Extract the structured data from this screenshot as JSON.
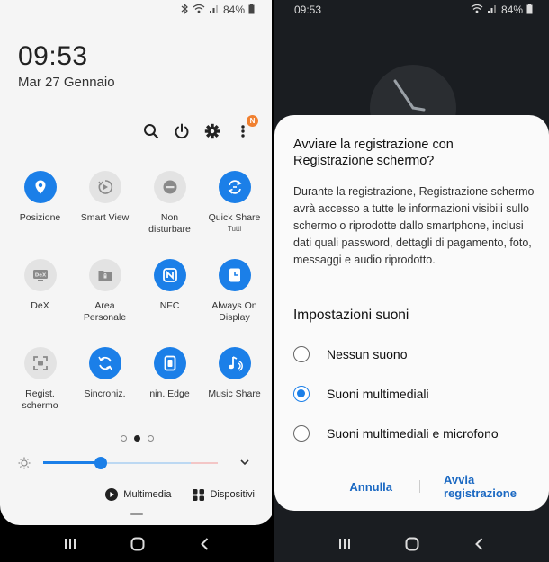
{
  "left": {
    "status": {
      "battery": "84%"
    },
    "clock": "09:53",
    "date": "Mar 27 Gennaio",
    "notification_badge": "N",
    "tiles": [
      {
        "label": "Posizione",
        "state": "on",
        "icon": "location-pin-icon"
      },
      {
        "label": "Smart View",
        "state": "off",
        "icon": "smart-view-icon"
      },
      {
        "label": "Non\ndisturbare",
        "state": "off",
        "icon": "do-not-disturb-icon"
      },
      {
        "label": "Quick Share",
        "sublabel": "Tutti",
        "state": "on",
        "icon": "quick-share-icon"
      },
      {
        "label": "DeX",
        "state": "off",
        "icon": "dex-icon"
      },
      {
        "label": "Area\nPersonale",
        "state": "off",
        "icon": "secure-folder-icon"
      },
      {
        "label": "NFC",
        "state": "on",
        "icon": "nfc-icon"
      },
      {
        "label": "Always On\nDisplay",
        "state": "on",
        "icon": "always-on-display-icon"
      },
      {
        "label": "Regist.\nschermo",
        "state": "off",
        "icon": "screen-record-icon"
      },
      {
        "label": "Sincroniz.",
        "state": "on",
        "icon": "sync-icon"
      },
      {
        "label": "nin. Edge",
        "state": "on",
        "icon": "edge-lighting-icon"
      },
      {
        "label": "Music Share",
        "state": "on",
        "icon": "music-share-icon"
      }
    ],
    "brightness": 0.33,
    "media_label": "Multimedia",
    "devices_label": "Dispositivi"
  },
  "right": {
    "status": {
      "time": "09:53",
      "battery": "84%"
    },
    "dialog": {
      "title": "Avviare la registrazione con Registrazione schermo?",
      "body": "Durante la registrazione, Registrazione schermo avrà accesso a tutte le informazioni visibili sullo schermo o riprodotte dallo smartphone, inclusi dati quali password, dettagli di pagamento, foto, messaggi e audio riprodotto.",
      "section_title": "Impostazioni suoni",
      "options": [
        {
          "label": "Nessun suono",
          "checked": false
        },
        {
          "label": "Suoni multimediali",
          "checked": true
        },
        {
          "label": "Suoni multimediali e microfono",
          "checked": false
        }
      ],
      "cancel_label": "Annulla",
      "confirm_label": "Avvia registrazione"
    }
  },
  "colors": {
    "accent": "#1b7fe8",
    "tile_off": "#e3e3e3",
    "badge": "#f08030"
  }
}
